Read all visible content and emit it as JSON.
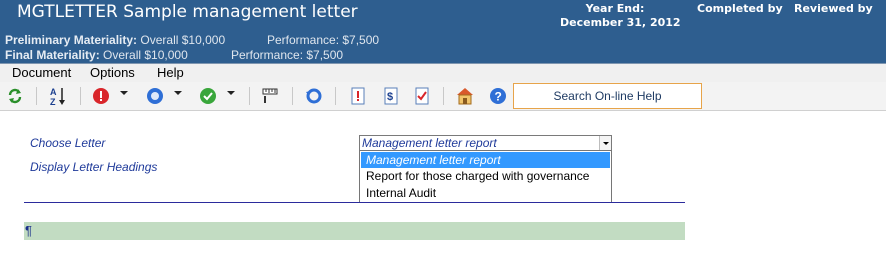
{
  "header": {
    "title": "MGTLETTER Sample management letter",
    "year_end_label": "Year End:",
    "year_end_date": "December 31, 2012",
    "completed_by": "Completed by",
    "reviewed_by": "Reviewed by",
    "preliminary_label": "Preliminary Materiality:",
    "preliminary_overall": "Overall $10,000",
    "preliminary_performance": "Performance: $7,500",
    "final_label": "Final Materiality:",
    "final_overall": "Overall $10,000",
    "final_performance": "Performance: $7,500"
  },
  "menu": {
    "items": [
      {
        "label": "Document"
      },
      {
        "label": "Options"
      },
      {
        "label": "Help"
      }
    ]
  },
  "toolbar": {
    "search_help": "Search On-line Help",
    "icons": [
      "refresh-icon",
      "sort-az-icon",
      "exclamation-icon",
      "circle-blue-icon",
      "checkmark-icon",
      "ruler-icon",
      "cycle-icon",
      "alert-doc-icon",
      "dollar-doc-icon",
      "check-doc-icon",
      "home-icon",
      "help-icon"
    ],
    "colors": {
      "red": "#d9262b",
      "blue": "#2f6fd6",
      "green": "#39a63b",
      "orange_border": "#e7a44a"
    }
  },
  "form": {
    "choose_letter_label": "Choose Letter",
    "display_headings_label": "Display Letter Headings",
    "selected_letter": "Management letter report",
    "options": [
      {
        "label": "Management letter report",
        "selected": true
      },
      {
        "label": "Report for those charged with governance",
        "selected": false
      },
      {
        "label": "Internal Audit",
        "selected": false
      }
    ],
    "paragraph_mark": "¶"
  },
  "colors": {
    "header_bg": "#2e5e8f",
    "label_text": "#1f3a9a",
    "selection": "#3399ff",
    "paragraph_bar": "#c2dcc2"
  }
}
